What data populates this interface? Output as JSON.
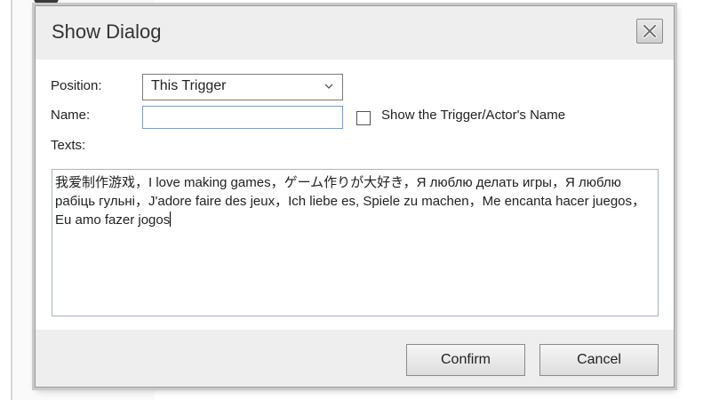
{
  "dialog": {
    "title": "Show Dialog",
    "close_icon": "close-x-icon"
  },
  "form": {
    "position_label": "Position:",
    "position_value": "This Trigger",
    "name_label": "Name:",
    "name_value": "",
    "show_name_checkbox_label": "Show the Trigger/Actor's Name",
    "show_name_checked": false,
    "texts_label": "Texts:",
    "texts_value": "我爱制作游戏，I love making games，ゲーム作りが大好き，Я люблю делать игры，Я люблю рабіць гульні，J'adore faire des jeux，Ich liebe es, Spiele zu machen，Me encanta hacer juegos，Eu amo fazer jogos"
  },
  "buttons": {
    "confirm_label": "Confirm",
    "cancel_label": "Cancel"
  },
  "colors": {
    "titlebar_bg": "#eeeeee",
    "footer_bg": "#eeeeee",
    "border": "#9a9a9a"
  }
}
